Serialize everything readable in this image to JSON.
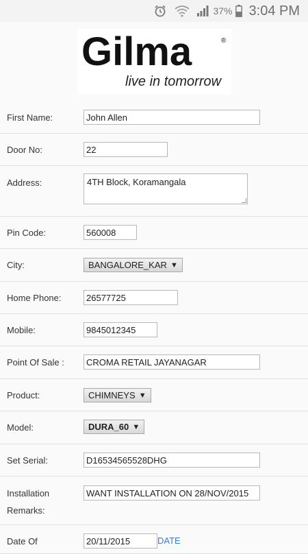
{
  "status_bar": {
    "alarm_icon": "alarm-icon",
    "wifi_icon": "wifi-icon",
    "signal_icon": "signal-icon",
    "battery_percent": "37%",
    "battery_icon": "battery-icon",
    "time": "3:04 PM"
  },
  "logo": {
    "brand": "Gilma",
    "registered": "®",
    "tagline": "live in tomorrow"
  },
  "form": {
    "first_name": {
      "label": "First Name:",
      "value": "John Allen"
    },
    "door_no": {
      "label": "Door No:",
      "value": "22"
    },
    "address": {
      "label": "Address:",
      "value": "4TH Block, Koramangala"
    },
    "pin_code": {
      "label": "Pin Code:",
      "value": "560008"
    },
    "city": {
      "label": "City:",
      "value": "BANGALORE_KAR"
    },
    "home_phone": {
      "label": "Home Phone:",
      "value": "26577725"
    },
    "mobile": {
      "label": "Mobile:",
      "value": "9845012345"
    },
    "point_of_sale": {
      "label": "Point Of Sale :",
      "value": "CROMA RETAIL JAYANAGAR"
    },
    "product": {
      "label": "Product:",
      "value": "CHIMNEYS"
    },
    "model": {
      "label": "Model:",
      "value": "DURA_60"
    },
    "set_serial": {
      "label": "Set Serial:",
      "value": "D16534565528DHG"
    },
    "installation_remarks": {
      "label_line1": "Installation",
      "label_line2": "Remarks:",
      "value": "WANT INSTALLATION ON 28/NOV/2015"
    },
    "date_of": {
      "label": "Date Of",
      "value": "20/11/2015",
      "button": "DATE"
    }
  },
  "select_arrow": "▼"
}
